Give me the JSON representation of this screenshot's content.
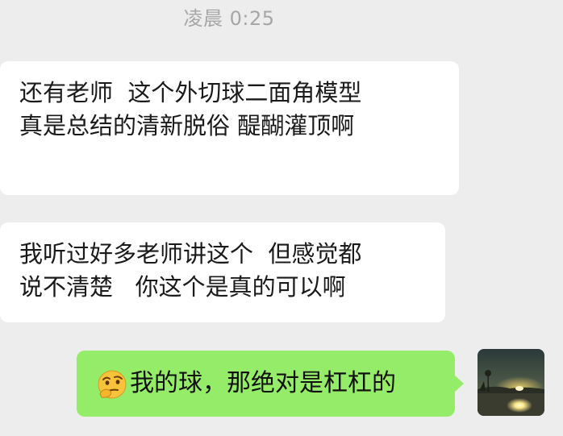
{
  "timestamp": "凌晨 0:25",
  "messages": [
    {
      "direction": "incoming",
      "lines": [
        "还有老师  这个外切球二面角模型",
        "真是总结的清新脱俗 醍醐灌顶啊"
      ]
    },
    {
      "direction": "incoming",
      "lines": [
        "我听过好多老师讲这个  但感觉都",
        "说不清楚   你这个是真的可以啊"
      ]
    },
    {
      "direction": "outgoing",
      "emoji": "thinking-face-emoji",
      "text": "我的球，那绝对是杠杠的"
    }
  ],
  "avatar": {
    "icon": "sunset-landscape-avatar"
  },
  "colors": {
    "background": "#ededed",
    "incoming_bubble": "#ffffff",
    "outgoing_bubble": "#95ec69",
    "timestamp_text": "#a6a6a6"
  }
}
